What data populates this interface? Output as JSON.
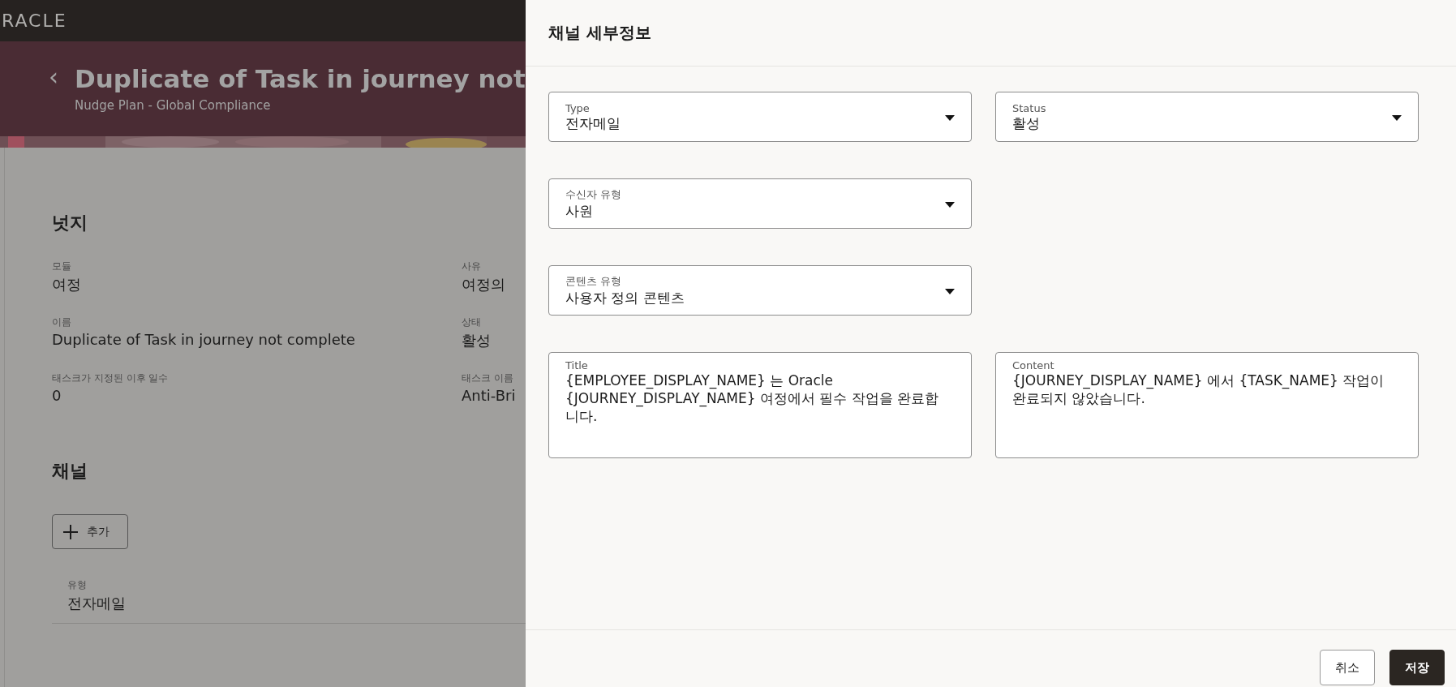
{
  "top_bar": {
    "logo": "RACLE"
  },
  "header": {
    "back": "‹",
    "title": "Duplicate of Task in journey not",
    "subtitle": "Nudge Plan - Global Compliance"
  },
  "nudge": {
    "heading": "넛지",
    "fields": [
      {
        "label": "모듈",
        "value": "여정"
      },
      {
        "label": "사유",
        "value": "여정의"
      },
      {
        "label": "이름",
        "value": "Duplicate of Task in journey not complete"
      },
      {
        "label": "상태",
        "value": "활성"
      },
      {
        "label": "태스크가 지정된 이후 일수",
        "value": "0"
      },
      {
        "label": "태스크 이름",
        "value": "Anti-Bri"
      }
    ]
  },
  "channels": {
    "heading": "채널",
    "add_button": "추가",
    "rows": [
      {
        "label": "유형",
        "value": "전자메일"
      }
    ]
  },
  "drawer": {
    "title": "채널 세부정보",
    "rows": [
      [
        {
          "kind": "select",
          "label": "Type",
          "value": "전자메일"
        },
        {
          "kind": "select",
          "label": "Status",
          "value": "활성"
        }
      ],
      [
        {
          "kind": "select",
          "label": "수신자 유형",
          "value": "사원"
        }
      ],
      [
        {
          "kind": "select",
          "label": "콘텐츠 유형",
          "value": "사용자 정의 콘텐츠"
        }
      ],
      [
        {
          "kind": "textarea",
          "label": "Title",
          "value": "{EMPLOYEE_DISPLAY_NAME} 는 Oracle {JOURNEY_DISPLAY_NAME} 여정에서 필수 작업을 완료합니다."
        },
        {
          "kind": "textarea",
          "label": "Content",
          "value": "{JOURNEY_DISPLAY_NAME} 에서 {TASK_NAME} 작업이 완료되지 않았습니다."
        }
      ]
    ],
    "buttons": [
      {
        "label": "취소",
        "kind": "secondary"
      },
      {
        "label": "저장",
        "kind": "primary"
      }
    ]
  }
}
